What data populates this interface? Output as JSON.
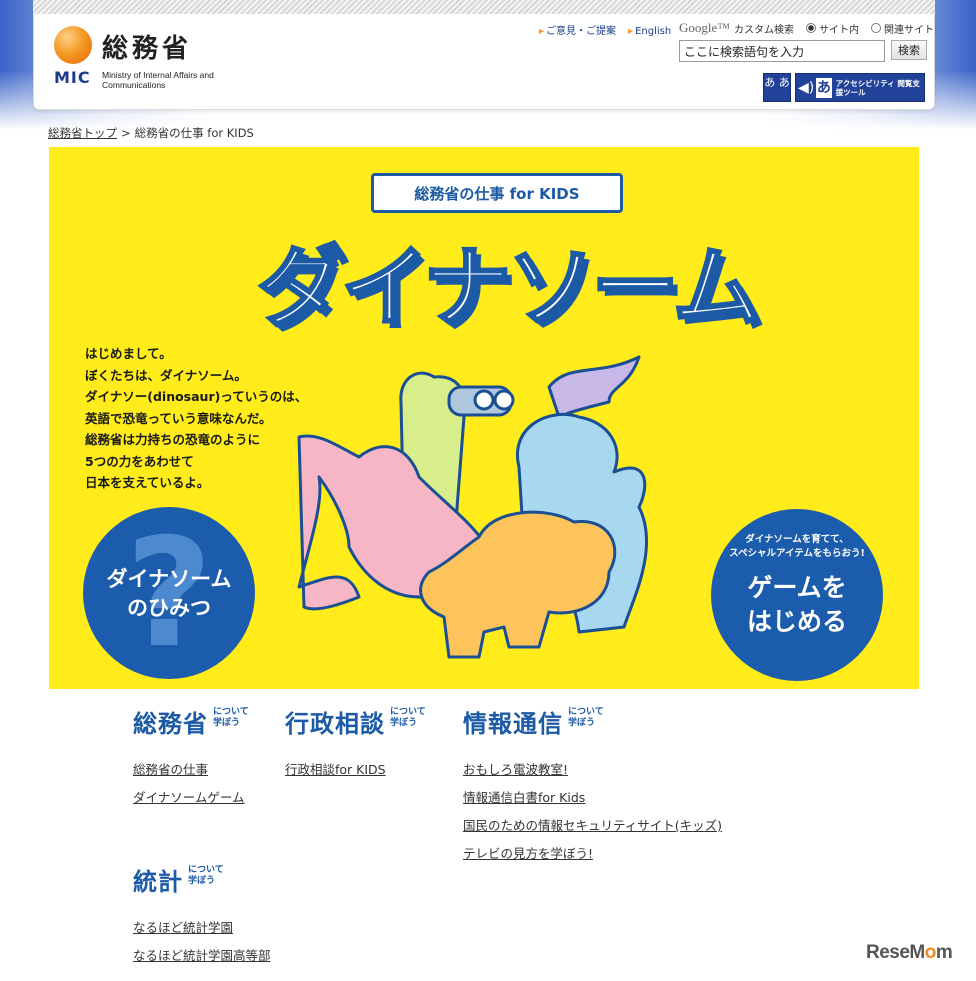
{
  "header": {
    "logo_jp": "総務省",
    "logo_mic": "MIC",
    "logo_en": "Ministry of Internal Affairs and Communications",
    "links": [
      "ご意見・ご提案",
      "English"
    ],
    "google_label": "Google™",
    "custom_search": "カスタム検索",
    "radio_site": "サイト内",
    "radio_related": "関連サイト",
    "search_placeholder": "ここに検索語句を入力",
    "search_button": "検索",
    "font_size_button": "あ あ",
    "accessibility_label": "アクセシビリティ 閲覧支援ツール",
    "accessibility_glyph": "あ"
  },
  "breadcrumb": {
    "home": "総務省トップ",
    "separator": ">",
    "current": "総務省の仕事 for KIDS"
  },
  "hero": {
    "banner": "総務省の仕事 for KIDS",
    "title": "ダイナソーム",
    "intro": "はじめまして。\nぼくたちは、ダイナソーム。\nダイナソー(dinosaur)っていうのは、\n英語で恐竜っていう意味なんだ。\n総務省は力持ちの恐竜のように\n5つの力をあわせて\n日本を支えているよ。",
    "secret_button": "ダイナソーム\nのひみつ",
    "secret_glyph": "?",
    "game_sub": "ダイナソームを育てて、\nスペシャルアイテムをもらおう!",
    "game_button": "ゲームを\nはじめる"
  },
  "sections": [
    {
      "title": "総務省",
      "sub": "について\n学ぼう",
      "links": [
        "総務省の仕事",
        "ダイナソームゲーム"
      ]
    },
    {
      "title": "行政相談",
      "sub": "について\n学ぼう",
      "links": [
        "行政相談for KIDS"
      ]
    },
    {
      "title": "情報通信",
      "sub": "について\n学ぼう",
      "links": [
        "おもしろ電波教室!",
        "情報通信白書for Kids",
        "国民のための情報セキュリティサイト(キッズ)",
        "テレビの見方を学ぼう!"
      ]
    },
    {
      "title": "統計",
      "sub": "について\n学ぼう",
      "links": [
        "なるほど統計学園",
        "なるほど統計学園高等部"
      ]
    }
  ],
  "watermark": {
    "pre": "ReseM",
    "o": "o",
    "post": "m"
  },
  "colors": {
    "brand_blue": "#1c5aa6",
    "hero_yellow": "#ffec1a",
    "accent_orange": "#f59a24"
  }
}
